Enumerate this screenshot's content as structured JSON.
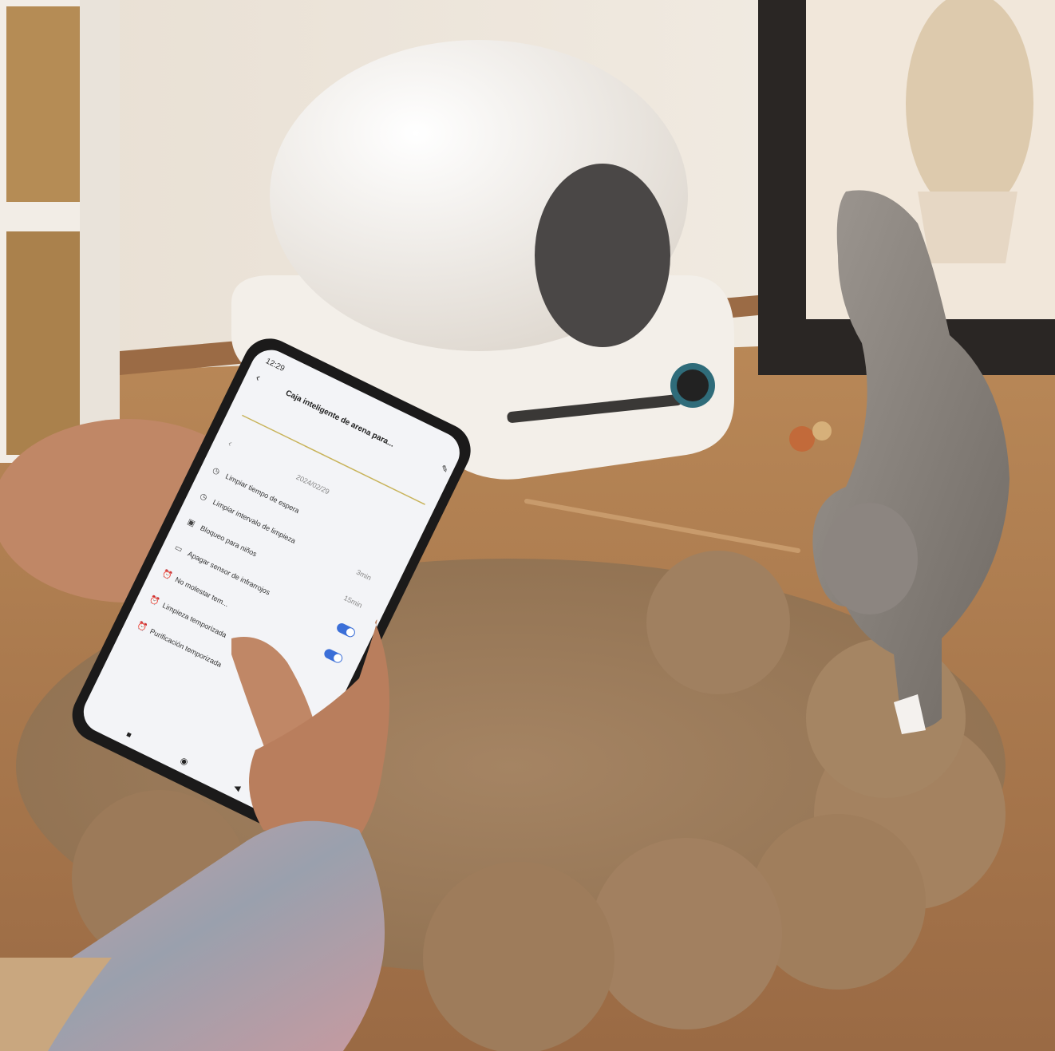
{
  "phone": {
    "status_time": "12:29",
    "title": "Caja inteligente de arena para...",
    "date": "2024/02/29",
    "settings": [
      {
        "label": "Limpiar tiempo de espera",
        "value": ""
      },
      {
        "label": "Limpiar intervalo de limpieza",
        "value": "3min"
      },
      {
        "label": "Bloqueo para niños",
        "value": "15min"
      },
      {
        "label": "Apagar sensor de infrarrojos",
        "value": ""
      },
      {
        "label": "No molestar tem...",
        "value": ""
      },
      {
        "label": "Limpieza temporizada",
        "value": ""
      },
      {
        "label": "Purificación temporizada",
        "value": ""
      }
    ]
  },
  "colors": {
    "wall": "#ece4d9",
    "floor": "#a9774c",
    "rug": "#b29674",
    "litter_box": "#f3efe9",
    "toggle_accent": "#3b6fd8"
  }
}
